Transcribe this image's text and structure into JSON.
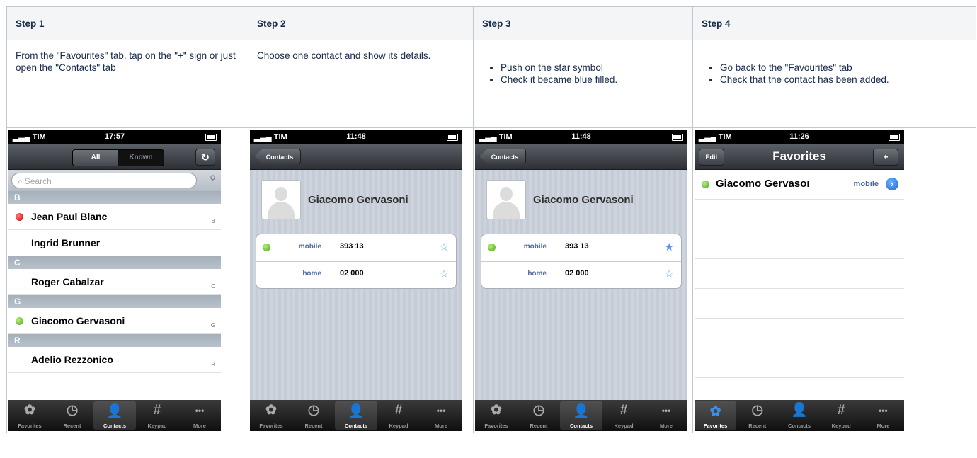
{
  "table": {
    "headers": [
      "Step 1",
      "Step 2",
      "Step 3",
      "Step 4"
    ],
    "step1_text": "From the \"Favourites\" tab, tap on the \"+\" sign or just open the \"Contacts\" tab",
    "step2_text": "Choose one contact and show its details.",
    "step3_bullets": [
      "Push on the star symbol",
      "Check it became blue filled."
    ],
    "step4_bullets": [
      "Go back to the \"Favourites\" tab",
      "Check that the contact has been added."
    ]
  },
  "tabbar": {
    "labels": [
      "Favorites",
      "Recent",
      "Contacts",
      "Keypad",
      "More"
    ],
    "icons": [
      "gear-icon",
      "clock-icon",
      "person-icon",
      "hash-icon",
      "ellipsis-icon"
    ]
  },
  "screen1": {
    "status": {
      "carrier": "TIM",
      "time": "17:57"
    },
    "segment": [
      "All",
      "Known"
    ],
    "refresh_icon": "↻",
    "search_placeholder": "Search",
    "search_index": "Q",
    "sections": [
      {
        "letter": "B",
        "contacts": [
          {
            "name": "Jean Paul Blanc",
            "status": "red",
            "index": "B"
          },
          {
            "name": "Ingrid Brunner",
            "status": "none",
            "index": ""
          }
        ]
      },
      {
        "letter": "C",
        "contacts": [
          {
            "name": "Roger Cabalzar",
            "status": "none",
            "index": "C"
          }
        ]
      },
      {
        "letter": "G",
        "contacts": [
          {
            "name": "Giacomo Gervasoni",
            "status": "green",
            "index": "G"
          }
        ]
      },
      {
        "letter": "R",
        "contacts": [
          {
            "name": "Adelio Rezzonico",
            "status": "none",
            "index": "R"
          }
        ]
      }
    ],
    "selected_tab": "Contacts"
  },
  "screen2": {
    "status": {
      "carrier": "TIM",
      "time": "11:48"
    },
    "back_label": "Contacts",
    "contact_name": "Giacomo Gervasoni",
    "rows": [
      {
        "label": "mobile",
        "number": "393 13",
        "star": "☆"
      },
      {
        "label": "home",
        "number": "02 000",
        "star": "☆"
      }
    ],
    "selected_tab": "Contacts"
  },
  "screen3": {
    "status": {
      "carrier": "TIM",
      "time": "11:48"
    },
    "back_label": "Contacts",
    "contact_name": "Giacomo Gervasoni",
    "rows": [
      {
        "label": "mobile",
        "number": "393 13",
        "star": "★"
      },
      {
        "label": "home",
        "number": "02 000",
        "star": "☆"
      }
    ],
    "selected_tab": "Contacts"
  },
  "screen4": {
    "status": {
      "carrier": "TIM",
      "time": "11:26"
    },
    "edit_label": "Edit",
    "title": "Favorites",
    "add_label": "+",
    "favorite": {
      "name": "Giacomo Gervasoı",
      "label": "mobile"
    },
    "selected_tab": "Favorites"
  },
  "colors": {
    "accent_blue": "#3d8ee6",
    "star_blue": "#7aa7e0",
    "online": "#4aa51a",
    "busy": "#d00000"
  }
}
